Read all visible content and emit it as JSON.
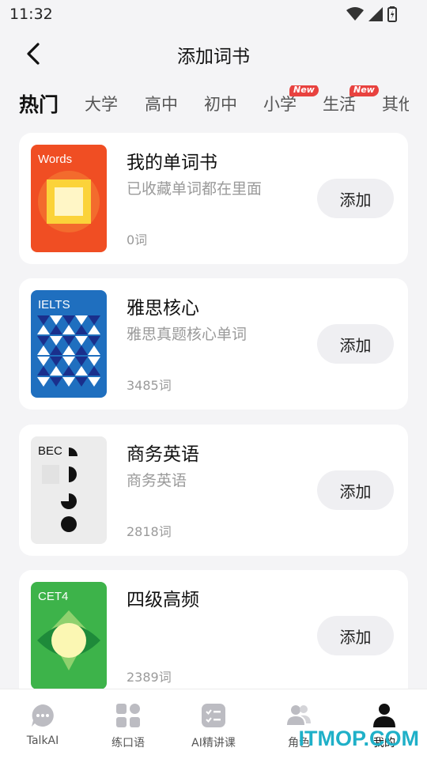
{
  "status_bar": {
    "time": "11:32"
  },
  "nav": {
    "title": "添加词书"
  },
  "tabs": [
    {
      "label": "热门",
      "active": true,
      "badge": ""
    },
    {
      "label": "大学",
      "active": false,
      "badge": ""
    },
    {
      "label": "高中",
      "active": false,
      "badge": ""
    },
    {
      "label": "初中",
      "active": false,
      "badge": ""
    },
    {
      "label": "小学",
      "active": false,
      "badge": "New"
    },
    {
      "label": "生活",
      "active": false,
      "badge": "New"
    },
    {
      "label": "其他",
      "active": false,
      "badge": ""
    }
  ],
  "books": [
    {
      "cover_label": "Words",
      "cover_color": "#f04e23",
      "title": "我的单词书",
      "desc": "已收藏单词都在里面",
      "count": "0词",
      "button": "添加"
    },
    {
      "cover_label": "IELTS",
      "cover_color": "#1f6fbf",
      "title": "雅思核心",
      "desc": "雅思真题核心单词",
      "count": "3485词",
      "button": "添加"
    },
    {
      "cover_label": "BEC",
      "cover_color": "#ececec",
      "title": "商务英语",
      "desc": "商务英语",
      "count": "2818词",
      "button": "添加"
    },
    {
      "cover_label": "CET4",
      "cover_color": "#3db34a",
      "title": "四级高频",
      "desc": "",
      "count": "2389词",
      "button": "添加"
    }
  ],
  "bottom_nav": [
    {
      "label": "TalkAI",
      "icon": "chat-bubble-icon",
      "active": false
    },
    {
      "label": "练口语",
      "icon": "grid-icon",
      "active": false
    },
    {
      "label": "AI精讲课",
      "icon": "checklist-icon",
      "active": false
    },
    {
      "label": "角色",
      "icon": "people-icon",
      "active": false
    },
    {
      "label": "我的",
      "icon": "person-icon",
      "active": true
    }
  ],
  "watermark": "ITMOP.COM"
}
